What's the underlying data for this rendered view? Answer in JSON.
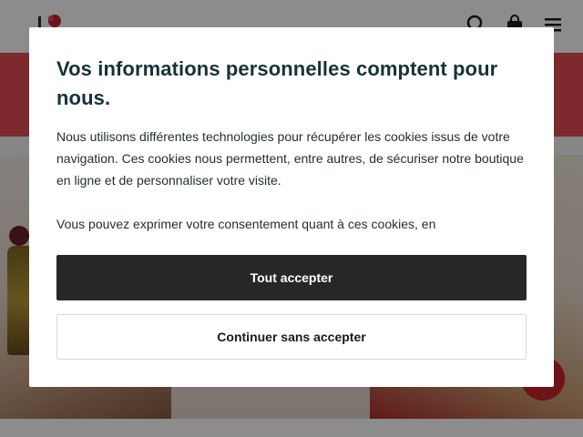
{
  "header": {
    "icons": [
      "logo-icon",
      "search-icon",
      "bag-icon",
      "menu-icon"
    ]
  },
  "consent": {
    "title": "Vos informations personnelles comptent pour nous.",
    "paragraph_1": "Nous utilisons différentes technologies pour récupérer les cookies issus de votre navigation. Ces cookies nous permettent, entre autres, de sécuriser notre boutique en ligne et de personnaliser votre visite.",
    "paragraph_2": "Vous pouvez exprimer votre consentement quant à ces cookies, en",
    "accept_all_label": "Tout accepter",
    "continue_without_label": "Continuer sans accepter"
  },
  "colors": {
    "promo_band": "#e64b53",
    "title": "#163239",
    "primary_button": "#272727",
    "overlay": "rgba(0,0,0,0.45)"
  }
}
